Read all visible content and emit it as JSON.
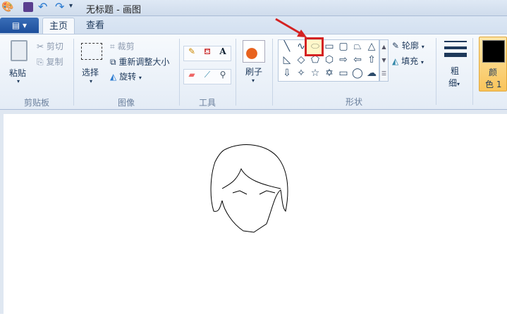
{
  "title": "无标题 - 画图",
  "tabs": [
    {
      "label": "主页",
      "active": true
    },
    {
      "label": "查看",
      "active": false
    }
  ],
  "clipboard": {
    "paste": "粘贴",
    "cut": "剪切",
    "copy": "复制",
    "group": "剪贴板"
  },
  "image": {
    "select": "选择",
    "crop": "裁剪",
    "resize": "重新调整大小",
    "rotate": "旋转",
    "group": "图像"
  },
  "tools": {
    "group": "工具",
    "items": [
      "pencil-icon",
      "fill-icon",
      "text-icon",
      "eraser-icon",
      "color-picker-icon",
      "magnifier-icon"
    ]
  },
  "brush": {
    "label": "刷子"
  },
  "shapes": {
    "group": "形状",
    "outline": "轮廓",
    "fill": "填充",
    "selected": "oval",
    "items": [
      "╲",
      "∿",
      "⬭",
      "▭",
      "▢",
      "⏢",
      "△",
      "◺",
      "◇",
      "⬠",
      "⬡",
      "⇨",
      "⇦",
      "⇧",
      "⇩",
      "✧",
      "☆",
      "✡",
      "▭",
      "◯",
      "☁"
    ]
  },
  "size": {
    "label1": "粗",
    "label2": "细"
  },
  "color1": {
    "label1": "颜",
    "label2": "色 1",
    "value": "#000000"
  },
  "accent": "#d42222"
}
